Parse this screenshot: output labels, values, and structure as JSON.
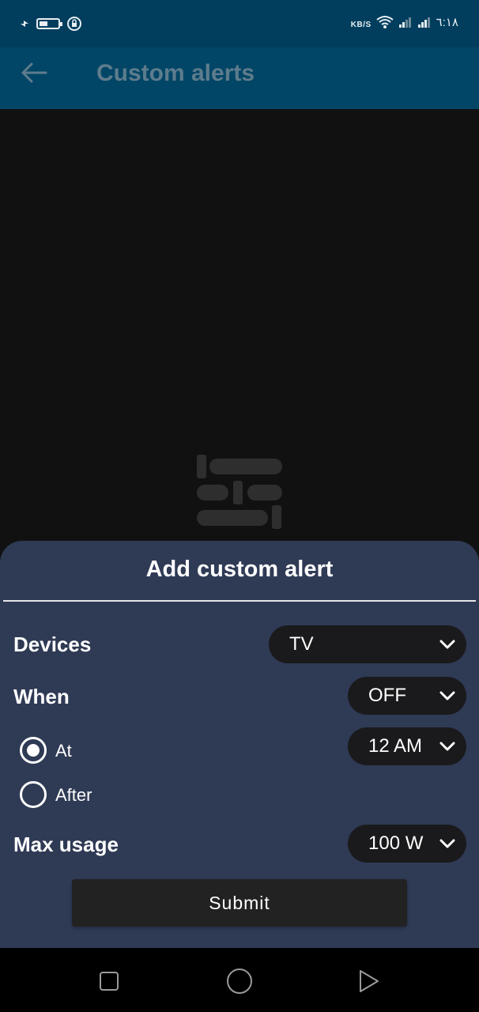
{
  "status_bar": {
    "time": "٦:١٨",
    "speed_unit": "KB/S"
  },
  "app_bar": {
    "title": "Custom alerts",
    "back_icon": "arrow-back-icon"
  },
  "sheet": {
    "title": "Add custom alert",
    "devices": {
      "label": "Devices",
      "value": "TV"
    },
    "when": {
      "label": "When",
      "value": "OFF"
    },
    "time_mode": {
      "options": [
        {
          "label": "At",
          "selected": true
        },
        {
          "label": "After",
          "selected": false
        }
      ],
      "time_value": "12 AM"
    },
    "max_usage": {
      "label": "Max usage",
      "value": "100 W"
    },
    "submit_label": "Submit"
  },
  "colors": {
    "status_bar": "#013e5e",
    "app_bar": "#024667",
    "sheet": "#2f3a55",
    "select_bg": "#1a1a1c",
    "content_bg": "#111111"
  },
  "nav_bar": {
    "icons": [
      "recents-square-icon",
      "home-circle-icon",
      "back-triangle-icon"
    ]
  }
}
